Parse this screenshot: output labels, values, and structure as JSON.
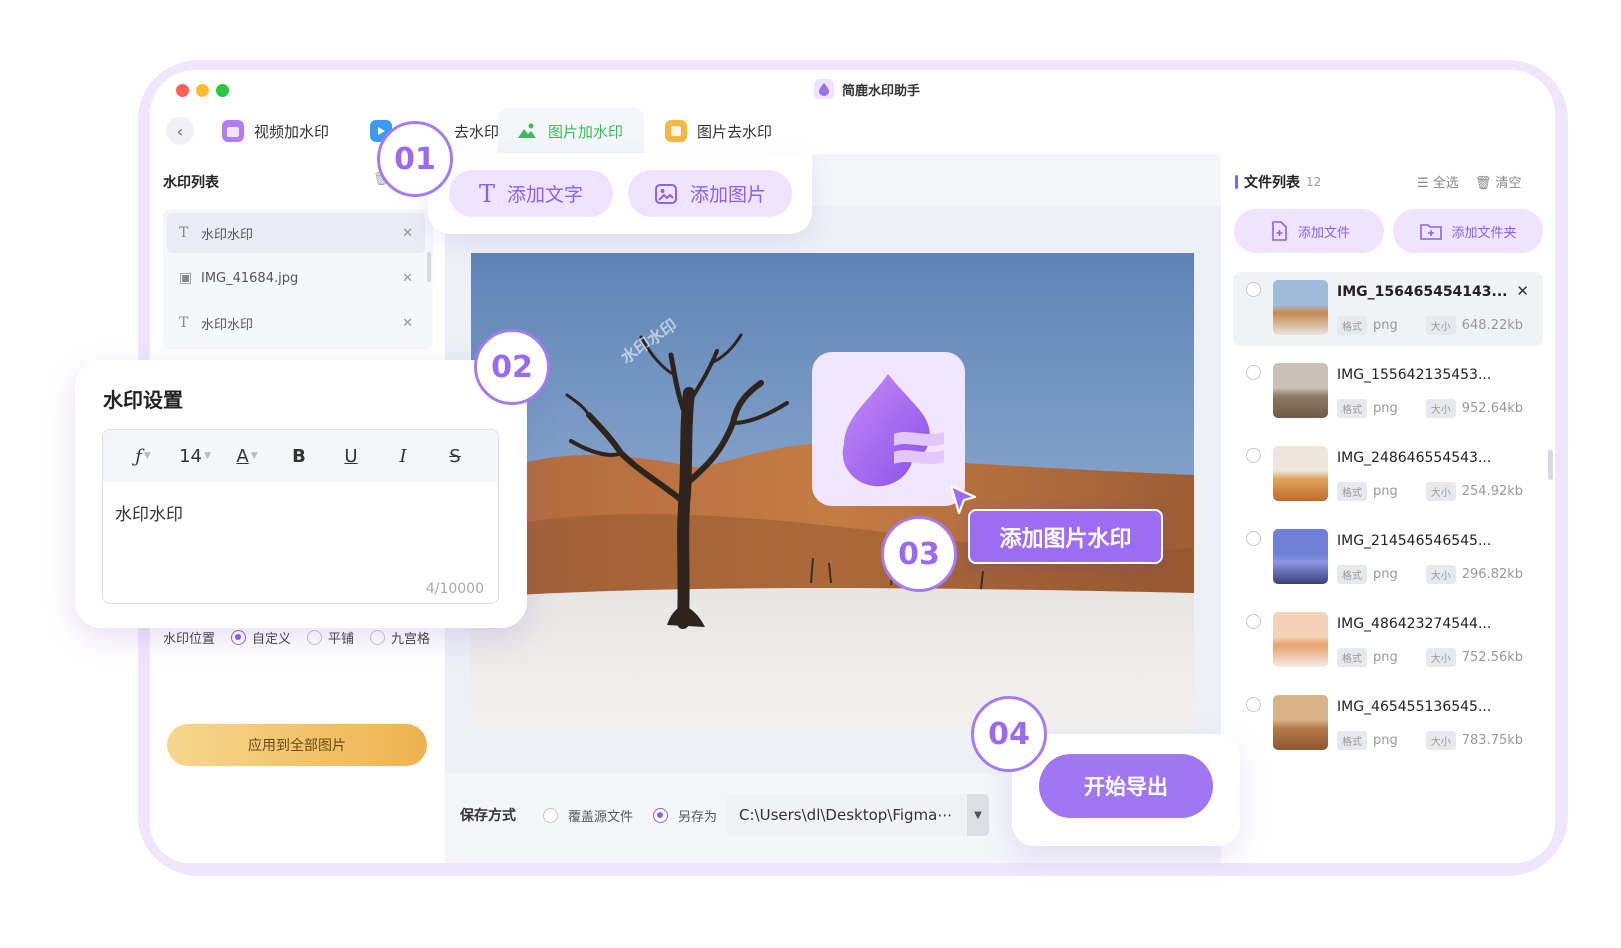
{
  "app": {
    "title": "简鹿水印助手"
  },
  "tabs": [
    {
      "label": "视频加水印",
      "active": false
    },
    {
      "label": "去水印",
      "active": false
    },
    {
      "label": "图片加水印",
      "active": true
    },
    {
      "label": "图片去水印",
      "active": false
    }
  ],
  "add_panel": {
    "add_text": "添加文字",
    "add_image": "添加图片"
  },
  "left": {
    "title": "水印列表",
    "items": [
      {
        "label": "水印水印",
        "type": "text"
      },
      {
        "label": "IMG_41684.jpg",
        "type": "image"
      },
      {
        "label": "水印水印",
        "type": "text"
      }
    ],
    "position_label": "水印位置",
    "position_options": [
      "自定义",
      "平铺",
      "九宫格"
    ],
    "position_selected": "自定义",
    "apply_button": "应用到全部图片"
  },
  "settings": {
    "title": "水印设置",
    "font_size": "14",
    "text": "水印水印",
    "counter": "4/10000"
  },
  "preview": {
    "watermark_text": "水印水印",
    "callout": "添加图片水印"
  },
  "save": {
    "label": "保存方式",
    "options": [
      "覆盖源文件",
      "另存为"
    ],
    "selected": "另存为",
    "path": "C:\\Users\\dl\\Desktop\\Figma⋯"
  },
  "export_button": "开始导出",
  "steps": [
    "01",
    "02",
    "03",
    "04"
  ],
  "right": {
    "title": "文件列表",
    "count": "12",
    "select_all": "全选",
    "clear": "清空",
    "add_file": "添加文件",
    "add_folder": "添加文件夹",
    "format_tag": "格式",
    "size_tag": "大小",
    "files": [
      {
        "name": "IMG_156465454143...",
        "format": "png",
        "size": "648.22kb",
        "selected": true
      },
      {
        "name": "IMG_155642135453...",
        "format": "png",
        "size": "952.64kb",
        "selected": false
      },
      {
        "name": "IMG_248646554543...",
        "format": "png",
        "size": "254.92kb",
        "selected": false
      },
      {
        "name": "IMG_214546546545...",
        "format": "png",
        "size": "296.82kb",
        "selected": false
      },
      {
        "name": "IMG_486423274544...",
        "format": "png",
        "size": "752.56kb",
        "selected": false
      },
      {
        "name": "IMG_465455136545...",
        "format": "png",
        "size": "783.75kb",
        "selected": false
      }
    ]
  },
  "colors": {
    "accent": "#8c62e8",
    "accent_light": "#efe3fd",
    "tab_active": "#3fba5a",
    "apply_btn": "#eeb24f"
  }
}
